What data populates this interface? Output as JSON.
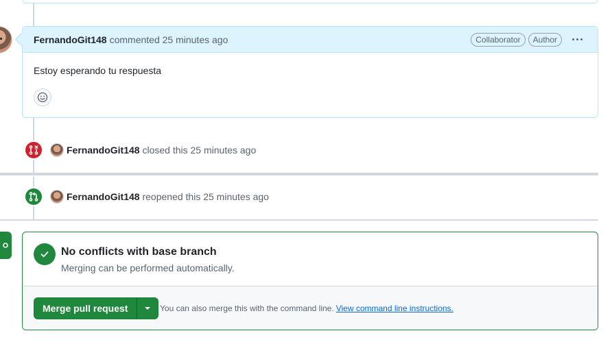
{
  "comment": {
    "author": "FernandoGit148",
    "action_text": "commented 25 minutes ago",
    "labels": [
      "Collaborator",
      "Author"
    ],
    "body": "Estoy esperando tu respuesta",
    "reaction_icon": "smiley-icon",
    "menu_icon": "kebab-horizontal-icon"
  },
  "events": [
    {
      "icon": "git-pull-request-closed-icon",
      "actor": "FernandoGit148",
      "text": "closed this 25 minutes ago",
      "color": "#cf222e"
    },
    {
      "icon": "git-pull-request-icon",
      "actor": "FernandoGit148",
      "text": "reopened this 25 minutes ago",
      "color": "#1f883d"
    }
  ],
  "merge": {
    "status_icon": "check-icon",
    "title": "No conflicts with base branch",
    "subtitle": "Merging can be performed automatically.",
    "button_label": "Merge pull request",
    "hint_text": "You can also merge this with the command line.",
    "hint_link": "View command line instructions.",
    "accent_color": "#1f883d"
  }
}
